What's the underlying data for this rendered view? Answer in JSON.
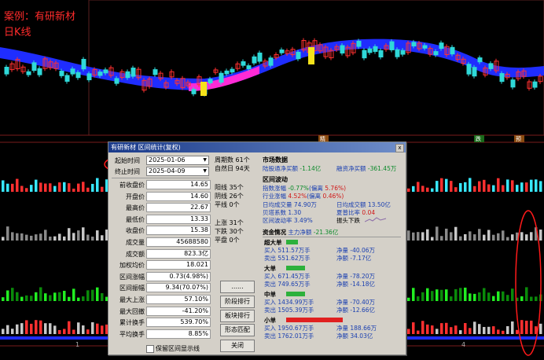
{
  "annotation": {
    "line1": "案例：有研新材",
    "line2": "日K线"
  },
  "chart_markers": {
    "m1": "精",
    "m2": "跌",
    "m3": "预"
  },
  "axis_bottom": {
    "t1": "1",
    "t2": "4"
  },
  "colors": {
    "background": "#000000",
    "band_blue": "#1f2dff",
    "band_magenta": "#ff2bd6",
    "up": "#ff3030",
    "down": "#2fd9d9",
    "yellow_candle": "#f5e21a",
    "ellipse": "#ff1a1a"
  },
  "dialog": {
    "title": "有研新材 区间统计(复权)",
    "close": "x",
    "start_label": "起始时间",
    "start_value": "2025-01-06",
    "end_label": "终止时间",
    "end_value": "2025-04-09",
    "rows": [
      {
        "label": "前收盘价",
        "value": "14.65"
      },
      {
        "label": "开盘价",
        "value": "14.60"
      },
      {
        "label": "最高价",
        "value": "22.67"
      },
      {
        "label": "最低价",
        "value": "13.33"
      },
      {
        "label": "收盘价",
        "value": "15.38"
      },
      {
        "label": "成交量",
        "value": "45688580"
      },
      {
        "label": "成交额",
        "value": "823.3亿"
      },
      {
        "label": "加权均价",
        "value": "18.021"
      },
      {
        "label": "区间涨幅",
        "value": "0.73(4.98%)"
      },
      {
        "label": "区间振幅",
        "value": "9.34(70.07%)"
      },
      {
        "label": "最大上涨",
        "value": "57.10%"
      },
      {
        "label": "最大回撤",
        "value": "-41.20%"
      },
      {
        "label": "累计换手",
        "value": "539.70%"
      },
      {
        "label": "平均换手",
        "value": "8.85%"
      }
    ],
    "checkbox_label": "保留区间显示线",
    "mid": {
      "period": "周期数 61个",
      "natural": "自然日 94天",
      "yang": "阳线 35个",
      "yin": "阴线 26个",
      "ping": "平线 0个",
      "up": "上涨 31个",
      "down": "下跌 30个",
      "flat": "平盘 0个"
    },
    "buttons": {
      "dots": "......",
      "rank": "阶段排行",
      "sector": "板块排行",
      "pattern": "形态匹配",
      "close": "关闭"
    },
    "market": {
      "title": "市场数据",
      "hk_label": "陆股通净买额",
      "hk_value": "-1.14亿",
      "margin_label": "融资净买额",
      "margin_value": "-361.45万"
    },
    "range": {
      "title": "区间波动",
      "index_label": "指数涨幅",
      "index_value": "-0.77%",
      "index_dev_label": "(偏离",
      "index_dev": "5.76%)",
      "ind_label": "行业涨幅",
      "ind_value": "4.52%",
      "ind_dev_label": "(偏离",
      "ind_dev": "0.46%)",
      "avgvol_label": "日均成交量",
      "avgvol_value": "74.90万",
      "avgturn_label": "日均成交额",
      "avgturn_value": "13.50亿",
      "beta_label": "贝塔系数",
      "beta_value": "1.30",
      "sharpe_label": "夏普比率",
      "sharpe_value": "0.04",
      "vol_label": "区间波动率",
      "vol_value": "3.49%",
      "trend_label": "振头下跌"
    },
    "funds": {
      "title": "资金情况",
      "main_label": "主力净额",
      "main_value": "-21.36亿",
      "groups": [
        {
          "name": "超大单",
          "buy": "买入 511.57万手",
          "sell": "卖出 551.62万手",
          "net_vol": "净量 -40.06万",
          "net_amt": "净额 -7.17亿",
          "color": "#2db13b",
          "width": 10
        },
        {
          "name": "大单",
          "buy": "买入 671.45万手",
          "sell": "卖出 749.65万手",
          "net_vol": "净量 -78.20万",
          "net_amt": "净额 -14.18亿",
          "color": "#2db13b",
          "width": 16
        },
        {
          "name": "中单",
          "buy": "买入 1434.99万手",
          "sell": "卖出 1505.39万手",
          "net_vol": "净量 -70.40万",
          "net_amt": "净额 -12.66亿",
          "color": "#2db13b",
          "width": 16
        },
        {
          "name": "小单",
          "buy": "买入 1950.67万手",
          "sell": "卖出 1762.01万手",
          "net_vol": "净量 188.66万",
          "net_amt": "净额 34.03亿",
          "color": "#e02020",
          "width": 48
        }
      ]
    }
  }
}
